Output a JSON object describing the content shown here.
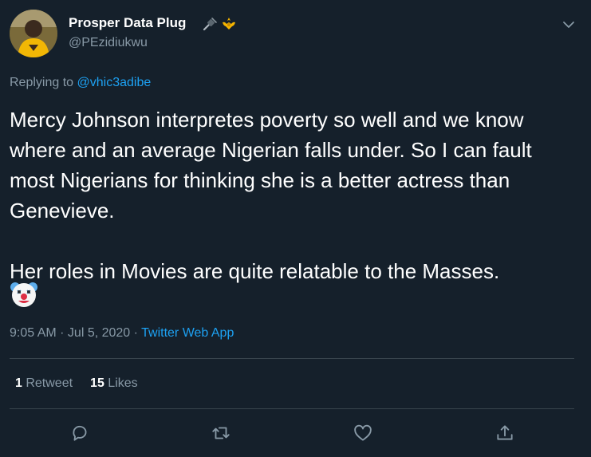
{
  "author": {
    "display_name": "Prosper Data Plug",
    "handle": "@PEzidiukwu",
    "name_emojis": [
      "plug-icon",
      "trident-crest-icon"
    ]
  },
  "reply": {
    "prefix": "Replying to ",
    "mention": "@vhic3adibe"
  },
  "tweet": {
    "paragraph1": "Mercy Johnson interpretes poverty so well and we know where and an average Nigerian falls under. So I can fault most Nigerians for thinking she is a better actress than Genevieve.",
    "paragraph2": "Her roles in Movies are quite relatable to the Masses.",
    "emoji": "clown-face-icon"
  },
  "meta": {
    "time": "9:05 AM",
    "separator": " · ",
    "date": "Jul 5, 2020",
    "app": "Twitter Web App"
  },
  "stats": {
    "retweets_count": "1",
    "retweets_label": " Retweet",
    "likes_count": "15",
    "likes_label": " Likes"
  },
  "actions": [
    "reply-icon",
    "retweet-icon",
    "like-icon",
    "share-icon"
  ],
  "colors": {
    "background": "#15202b",
    "text": "#ffffff",
    "secondary": "#8899a6",
    "accent": "#1da1f2",
    "divider": "#38444d"
  }
}
